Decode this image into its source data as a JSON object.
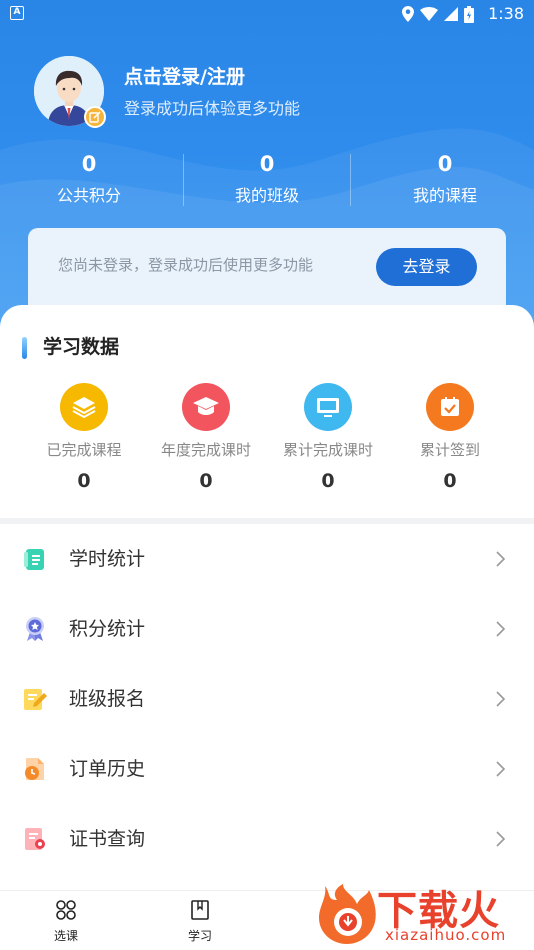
{
  "status_bar": {
    "app_badge": "A",
    "time": "1:38"
  },
  "profile": {
    "title": "点击登录/注册",
    "subtitle": "登录成功后体验更多功能"
  },
  "stats": [
    {
      "value": "0",
      "label": "公共积分"
    },
    {
      "value": "0",
      "label": "我的班级"
    },
    {
      "value": "0",
      "label": "我的课程"
    }
  ],
  "banner": {
    "text": "您尚未登录，登录成功后使用更多功能",
    "button": "去登录"
  },
  "study": {
    "title": "学习数据",
    "metrics": [
      {
        "label": "已完成课程",
        "value": "0",
        "icon": "layers-icon",
        "color": "#f7b800"
      },
      {
        "label": "年度完成课时",
        "value": "0",
        "icon": "graduation-cap-icon",
        "color": "#f2555e"
      },
      {
        "label": "累计完成课时",
        "value": "0",
        "icon": "monitor-icon",
        "color": "#3fb7ef"
      },
      {
        "label": "累计签到",
        "value": "0",
        "icon": "calendar-check-icon",
        "color": "#f57a1f"
      }
    ]
  },
  "menu": [
    {
      "label": "学时统计",
      "icon": "notebook-icon"
    },
    {
      "label": "积分统计",
      "icon": "medal-icon"
    },
    {
      "label": "班级报名",
      "icon": "edit-form-icon"
    },
    {
      "label": "订单历史",
      "icon": "order-clock-icon"
    },
    {
      "label": "证书查询",
      "icon": "certificate-icon"
    }
  ],
  "tabs": [
    {
      "label": "选课",
      "icon": "grid-icon"
    },
    {
      "label": "学习",
      "icon": "book-icon"
    }
  ],
  "watermark": {
    "text": "下载火",
    "url": "xiazaihuo.com"
  }
}
